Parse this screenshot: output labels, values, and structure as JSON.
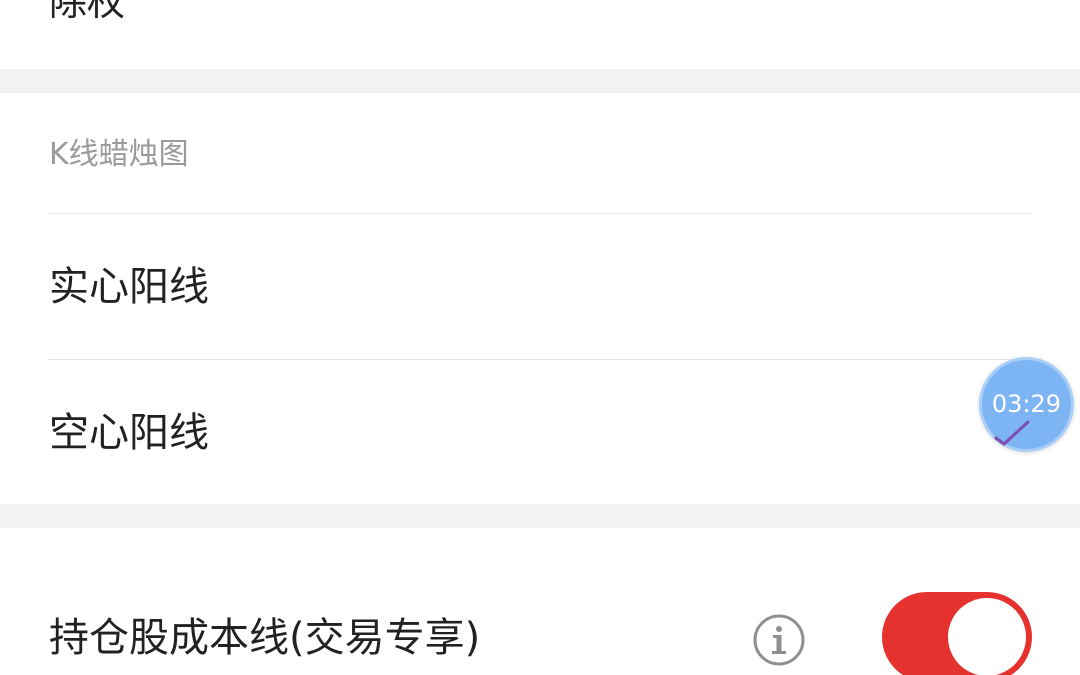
{
  "top": {
    "label": "除权"
  },
  "kline": {
    "section_title": "K线蜡烛图",
    "options": [
      {
        "label": "实心阳线",
        "selected": false
      },
      {
        "label": "空心阳线",
        "selected": true
      }
    ]
  },
  "floating_timer": {
    "time": "03:29",
    "color": "#7db4f3"
  },
  "cost_line": {
    "label": "持仓股成本线(交易专享)",
    "info_icon": "info-icon",
    "toggle_on": true,
    "toggle_color": "#e6322f"
  }
}
